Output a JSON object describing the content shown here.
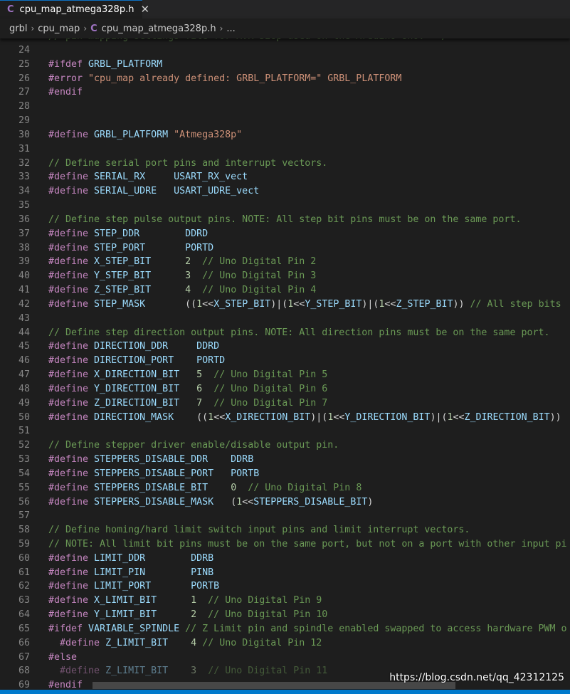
{
  "tab": {
    "lang_icon": "C",
    "title": "cpu_map_atmega328p.h",
    "close_glyph": "✕"
  },
  "breadcrumb": {
    "items": [
      "grbl",
      "cpu_map",
      "cpu_map_atmega328p.h",
      "..."
    ],
    "separator": "›",
    "file_icon": "C"
  },
  "partial_top_line": "// pin mapping settings file for AVR 328p used on the Arduino Uno.  */",
  "code_lines": [
    {
      "n": "24",
      "t": []
    },
    {
      "n": "25",
      "t": [
        [
          "kw",
          "#ifdef "
        ],
        [
          "id",
          "GRBL_PLATFORM"
        ]
      ]
    },
    {
      "n": "26",
      "t": [
        [
          "kw",
          "#error "
        ],
        [
          "str",
          "\"cpu_map already defined: GRBL_PLATFORM=\" "
        ],
        [
          "str",
          "GRBL_PLATFORM"
        ]
      ]
    },
    {
      "n": "27",
      "t": [
        [
          "kw",
          "#endif"
        ]
      ]
    },
    {
      "n": "28",
      "t": []
    },
    {
      "n": "29",
      "t": []
    },
    {
      "n": "30",
      "t": [
        [
          "kw",
          "#define "
        ],
        [
          "id",
          "GRBL_PLATFORM "
        ],
        [
          "str",
          "\"Atmega328p\""
        ]
      ]
    },
    {
      "n": "31",
      "t": []
    },
    {
      "n": "32",
      "t": [
        [
          "cm",
          "// Define serial port pins and interrupt vectors."
        ]
      ]
    },
    {
      "n": "33",
      "t": [
        [
          "kw",
          "#define "
        ],
        [
          "id",
          "SERIAL_RX     USART_RX_vect"
        ]
      ]
    },
    {
      "n": "34",
      "t": [
        [
          "kw",
          "#define "
        ],
        [
          "id",
          "SERIAL_UDRE   USART_UDRE_vect"
        ]
      ]
    },
    {
      "n": "35",
      "t": []
    },
    {
      "n": "36",
      "t": [
        [
          "cm",
          "// Define step pulse output pins. NOTE: All step bit pins must be on the same port."
        ]
      ]
    },
    {
      "n": "37",
      "t": [
        [
          "kw",
          "#define "
        ],
        [
          "id",
          "STEP_DDR        DDRD"
        ]
      ]
    },
    {
      "n": "38",
      "t": [
        [
          "kw",
          "#define "
        ],
        [
          "id",
          "STEP_PORT       PORTD"
        ]
      ]
    },
    {
      "n": "39",
      "t": [
        [
          "kw",
          "#define "
        ],
        [
          "id",
          "X_STEP_BIT      "
        ],
        [
          "num",
          "2"
        ],
        [
          "pl",
          "  "
        ],
        [
          "cm",
          "// Uno Digital Pin 2"
        ]
      ]
    },
    {
      "n": "40",
      "t": [
        [
          "kw",
          "#define "
        ],
        [
          "id",
          "Y_STEP_BIT      "
        ],
        [
          "num",
          "3"
        ],
        [
          "pl",
          "  "
        ],
        [
          "cm",
          "// Uno Digital Pin 3"
        ]
      ]
    },
    {
      "n": "41",
      "t": [
        [
          "kw",
          "#define "
        ],
        [
          "id",
          "Z_STEP_BIT      "
        ],
        [
          "num",
          "4"
        ],
        [
          "pl",
          "  "
        ],
        [
          "cm",
          "// Uno Digital Pin 4"
        ]
      ]
    },
    {
      "n": "42",
      "t": [
        [
          "kw",
          "#define "
        ],
        [
          "id",
          "STEP_MASK       "
        ],
        [
          "pl",
          "(("
        ],
        [
          "num",
          "1"
        ],
        [
          "pl",
          "<<"
        ],
        [
          "id",
          "X_STEP_BIT"
        ],
        [
          "pl",
          ")|("
        ],
        [
          "num",
          "1"
        ],
        [
          "pl",
          "<<"
        ],
        [
          "id",
          "Y_STEP_BIT"
        ],
        [
          "pl",
          ")|("
        ],
        [
          "num",
          "1"
        ],
        [
          "pl",
          "<<"
        ],
        [
          "id",
          "Z_STEP_BIT"
        ],
        [
          "pl",
          ")) "
        ],
        [
          "cm",
          "// All step bits"
        ]
      ]
    },
    {
      "n": "43",
      "t": []
    },
    {
      "n": "44",
      "t": [
        [
          "cm",
          "// Define step direction output pins. NOTE: All direction pins must be on the same port."
        ]
      ]
    },
    {
      "n": "45",
      "t": [
        [
          "kw",
          "#define "
        ],
        [
          "id",
          "DIRECTION_DDR     DDRD"
        ]
      ]
    },
    {
      "n": "46",
      "t": [
        [
          "kw",
          "#define "
        ],
        [
          "id",
          "DIRECTION_PORT    PORTD"
        ]
      ]
    },
    {
      "n": "47",
      "t": [
        [
          "kw",
          "#define "
        ],
        [
          "id",
          "X_DIRECTION_BIT   "
        ],
        [
          "num",
          "5"
        ],
        [
          "pl",
          "  "
        ],
        [
          "cm",
          "// Uno Digital Pin 5"
        ]
      ]
    },
    {
      "n": "48",
      "t": [
        [
          "kw",
          "#define "
        ],
        [
          "id",
          "Y_DIRECTION_BIT   "
        ],
        [
          "num",
          "6"
        ],
        [
          "pl",
          "  "
        ],
        [
          "cm",
          "// Uno Digital Pin 6"
        ]
      ]
    },
    {
      "n": "49",
      "t": [
        [
          "kw",
          "#define "
        ],
        [
          "id",
          "Z_DIRECTION_BIT   "
        ],
        [
          "num",
          "7"
        ],
        [
          "pl",
          "  "
        ],
        [
          "cm",
          "// Uno Digital Pin 7"
        ]
      ]
    },
    {
      "n": "50",
      "t": [
        [
          "kw",
          "#define "
        ],
        [
          "id",
          "DIRECTION_MASK    "
        ],
        [
          "pl",
          "(("
        ],
        [
          "num",
          "1"
        ],
        [
          "pl",
          "<<"
        ],
        [
          "id",
          "X_DIRECTION_BIT"
        ],
        [
          "pl",
          ")|("
        ],
        [
          "num",
          "1"
        ],
        [
          "pl",
          "<<"
        ],
        [
          "id",
          "Y_DIRECTION_BIT"
        ],
        [
          "pl",
          ")|("
        ],
        [
          "num",
          "1"
        ],
        [
          "pl",
          "<<"
        ],
        [
          "id",
          "Z_DIRECTION_BIT"
        ],
        [
          "pl",
          "))"
        ]
      ]
    },
    {
      "n": "51",
      "t": []
    },
    {
      "n": "52",
      "t": [
        [
          "cm",
          "// Define stepper driver enable/disable output pin."
        ]
      ]
    },
    {
      "n": "53",
      "t": [
        [
          "kw",
          "#define "
        ],
        [
          "id",
          "STEPPERS_DISABLE_DDR    DDRB"
        ]
      ]
    },
    {
      "n": "54",
      "t": [
        [
          "kw",
          "#define "
        ],
        [
          "id",
          "STEPPERS_DISABLE_PORT   PORTB"
        ]
      ]
    },
    {
      "n": "55",
      "t": [
        [
          "kw",
          "#define "
        ],
        [
          "id",
          "STEPPERS_DISABLE_BIT    "
        ],
        [
          "num",
          "0"
        ],
        [
          "pl",
          "  "
        ],
        [
          "cm",
          "// Uno Digital Pin 8"
        ]
      ]
    },
    {
      "n": "56",
      "t": [
        [
          "kw",
          "#define "
        ],
        [
          "id",
          "STEPPERS_DISABLE_MASK   "
        ],
        [
          "pl",
          "("
        ],
        [
          "num",
          "1"
        ],
        [
          "pl",
          "<<"
        ],
        [
          "id",
          "STEPPERS_DISABLE_BIT"
        ],
        [
          "pl",
          ")"
        ]
      ]
    },
    {
      "n": "57",
      "t": []
    },
    {
      "n": "58",
      "t": [
        [
          "cm",
          "// Define homing/hard limit switch input pins and limit interrupt vectors."
        ]
      ]
    },
    {
      "n": "59",
      "t": [
        [
          "cm",
          "// NOTE: All limit bit pins must be on the same port, but not on a port with other input pi"
        ]
      ]
    },
    {
      "n": "60",
      "t": [
        [
          "kw",
          "#define "
        ],
        [
          "id",
          "LIMIT_DDR        DDRB"
        ]
      ]
    },
    {
      "n": "61",
      "t": [
        [
          "kw",
          "#define "
        ],
        [
          "id",
          "LIMIT_PIN        PINB"
        ]
      ]
    },
    {
      "n": "62",
      "t": [
        [
          "kw",
          "#define "
        ],
        [
          "id",
          "LIMIT_PORT       PORTB"
        ]
      ]
    },
    {
      "n": "63",
      "t": [
        [
          "kw",
          "#define "
        ],
        [
          "id",
          "X_LIMIT_BIT      "
        ],
        [
          "num",
          "1"
        ],
        [
          "pl",
          "  "
        ],
        [
          "cm",
          "// Uno Digital Pin 9"
        ]
      ]
    },
    {
      "n": "64",
      "t": [
        [
          "kw",
          "#define "
        ],
        [
          "id",
          "Y_LIMIT_BIT      "
        ],
        [
          "num",
          "2"
        ],
        [
          "pl",
          "  "
        ],
        [
          "cm",
          "// Uno Digital Pin 10"
        ]
      ]
    },
    {
      "n": "65",
      "t": [
        [
          "kw",
          "#ifdef "
        ],
        [
          "id",
          "VARIABLE_SPINDLE "
        ],
        [
          "cm",
          "// Z Limit pin and spindle enabled swapped to access hardware PWM o"
        ]
      ]
    },
    {
      "n": "66",
      "t": [
        [
          "pl",
          "  "
        ],
        [
          "kw",
          "#define "
        ],
        [
          "id",
          "Z_LIMIT_BIT    "
        ],
        [
          "num",
          "4"
        ],
        [
          "pl",
          " "
        ],
        [
          "cm",
          "// Uno Digital Pin 12"
        ]
      ]
    },
    {
      "n": "67",
      "t": [
        [
          "kw",
          "#else"
        ]
      ]
    },
    {
      "n": "68",
      "t": [
        [
          "pl",
          "  "
        ],
        [
          "kw",
          "#define "
        ],
        [
          "id",
          "Z_LIMIT_BIT    "
        ],
        [
          "num",
          "3"
        ],
        [
          "pl",
          "  "
        ],
        [
          "cm",
          "// Uno Digital Pin 11"
        ]
      ],
      "dim": true
    },
    {
      "n": "69",
      "t": [
        [
          "kw",
          "#endif"
        ]
      ]
    }
  ],
  "watermark": "https://blog.csdn.net/qq_42312125",
  "colors": {
    "background": "#1e1e1e",
    "keyword": "#c586c0",
    "identifier": "#9cdcfe",
    "string": "#ce9178",
    "comment": "#6a9955",
    "number": "#b5cea8",
    "status_bar": "#007acc"
  }
}
